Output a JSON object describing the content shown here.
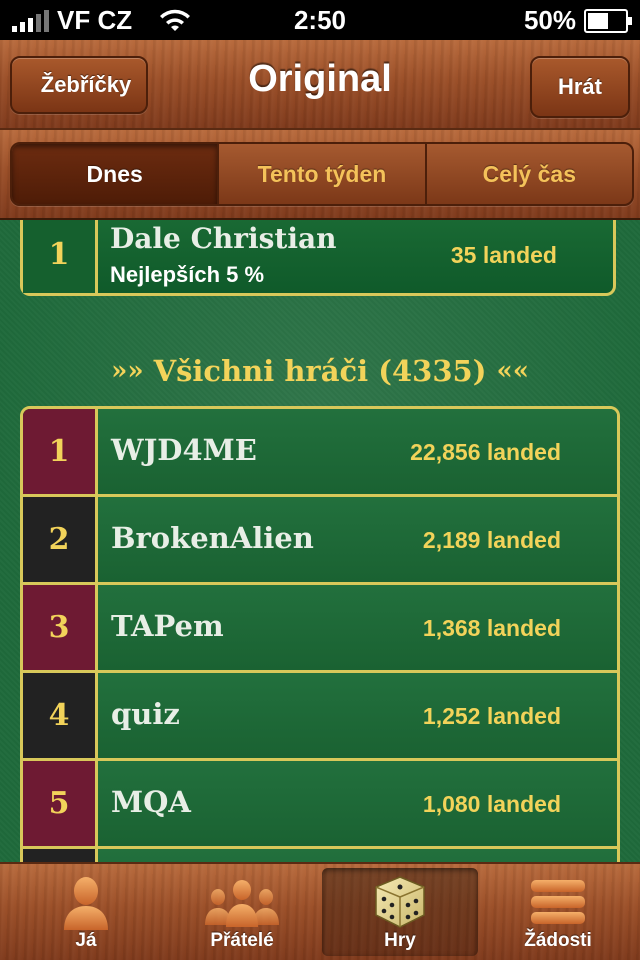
{
  "status_bar": {
    "carrier": "VF CZ",
    "time": "2:50",
    "battery": "50%"
  },
  "nav": {
    "back_label": "Žebříčky",
    "title": "Original",
    "action_label": "Hrát"
  },
  "segments": [
    {
      "label": "Dnes",
      "active": true
    },
    {
      "label": "Tento týden",
      "active": false
    },
    {
      "label": "Celý čas",
      "active": false
    }
  ],
  "my_entry": {
    "rank": "1",
    "name": "Dale Christian",
    "subtitle": "Nejlepších 5 %",
    "score": "35 landed"
  },
  "section": {
    "title": "Všichni hráči (4335)"
  },
  "leaderboard": [
    {
      "rank": "1",
      "name": "WJD4ME",
      "score": "22,856 landed"
    },
    {
      "rank": "2",
      "name": "BrokenAlien",
      "score": "2,189 landed"
    },
    {
      "rank": "3",
      "name": "TAPem",
      "score": "1,368 landed"
    },
    {
      "rank": "4",
      "name": "quiz",
      "score": "1,252 landed"
    },
    {
      "rank": "5",
      "name": "MQA",
      "score": "1,080 landed"
    }
  ],
  "tabbar": [
    {
      "label": "Já",
      "icon": "person-icon"
    },
    {
      "label": "Přátelé",
      "icon": "friends-icon"
    },
    {
      "label": "Hry",
      "icon": "dice-icon",
      "active": true
    },
    {
      "label": "Žádosti",
      "icon": "requests-icon"
    }
  ],
  "colors": {
    "felt": "#1f6a3b",
    "gold": "#f2d35a",
    "wood": "#9b4f28",
    "rank_odd": "#6e1a33",
    "rank_even": "#222222"
  }
}
